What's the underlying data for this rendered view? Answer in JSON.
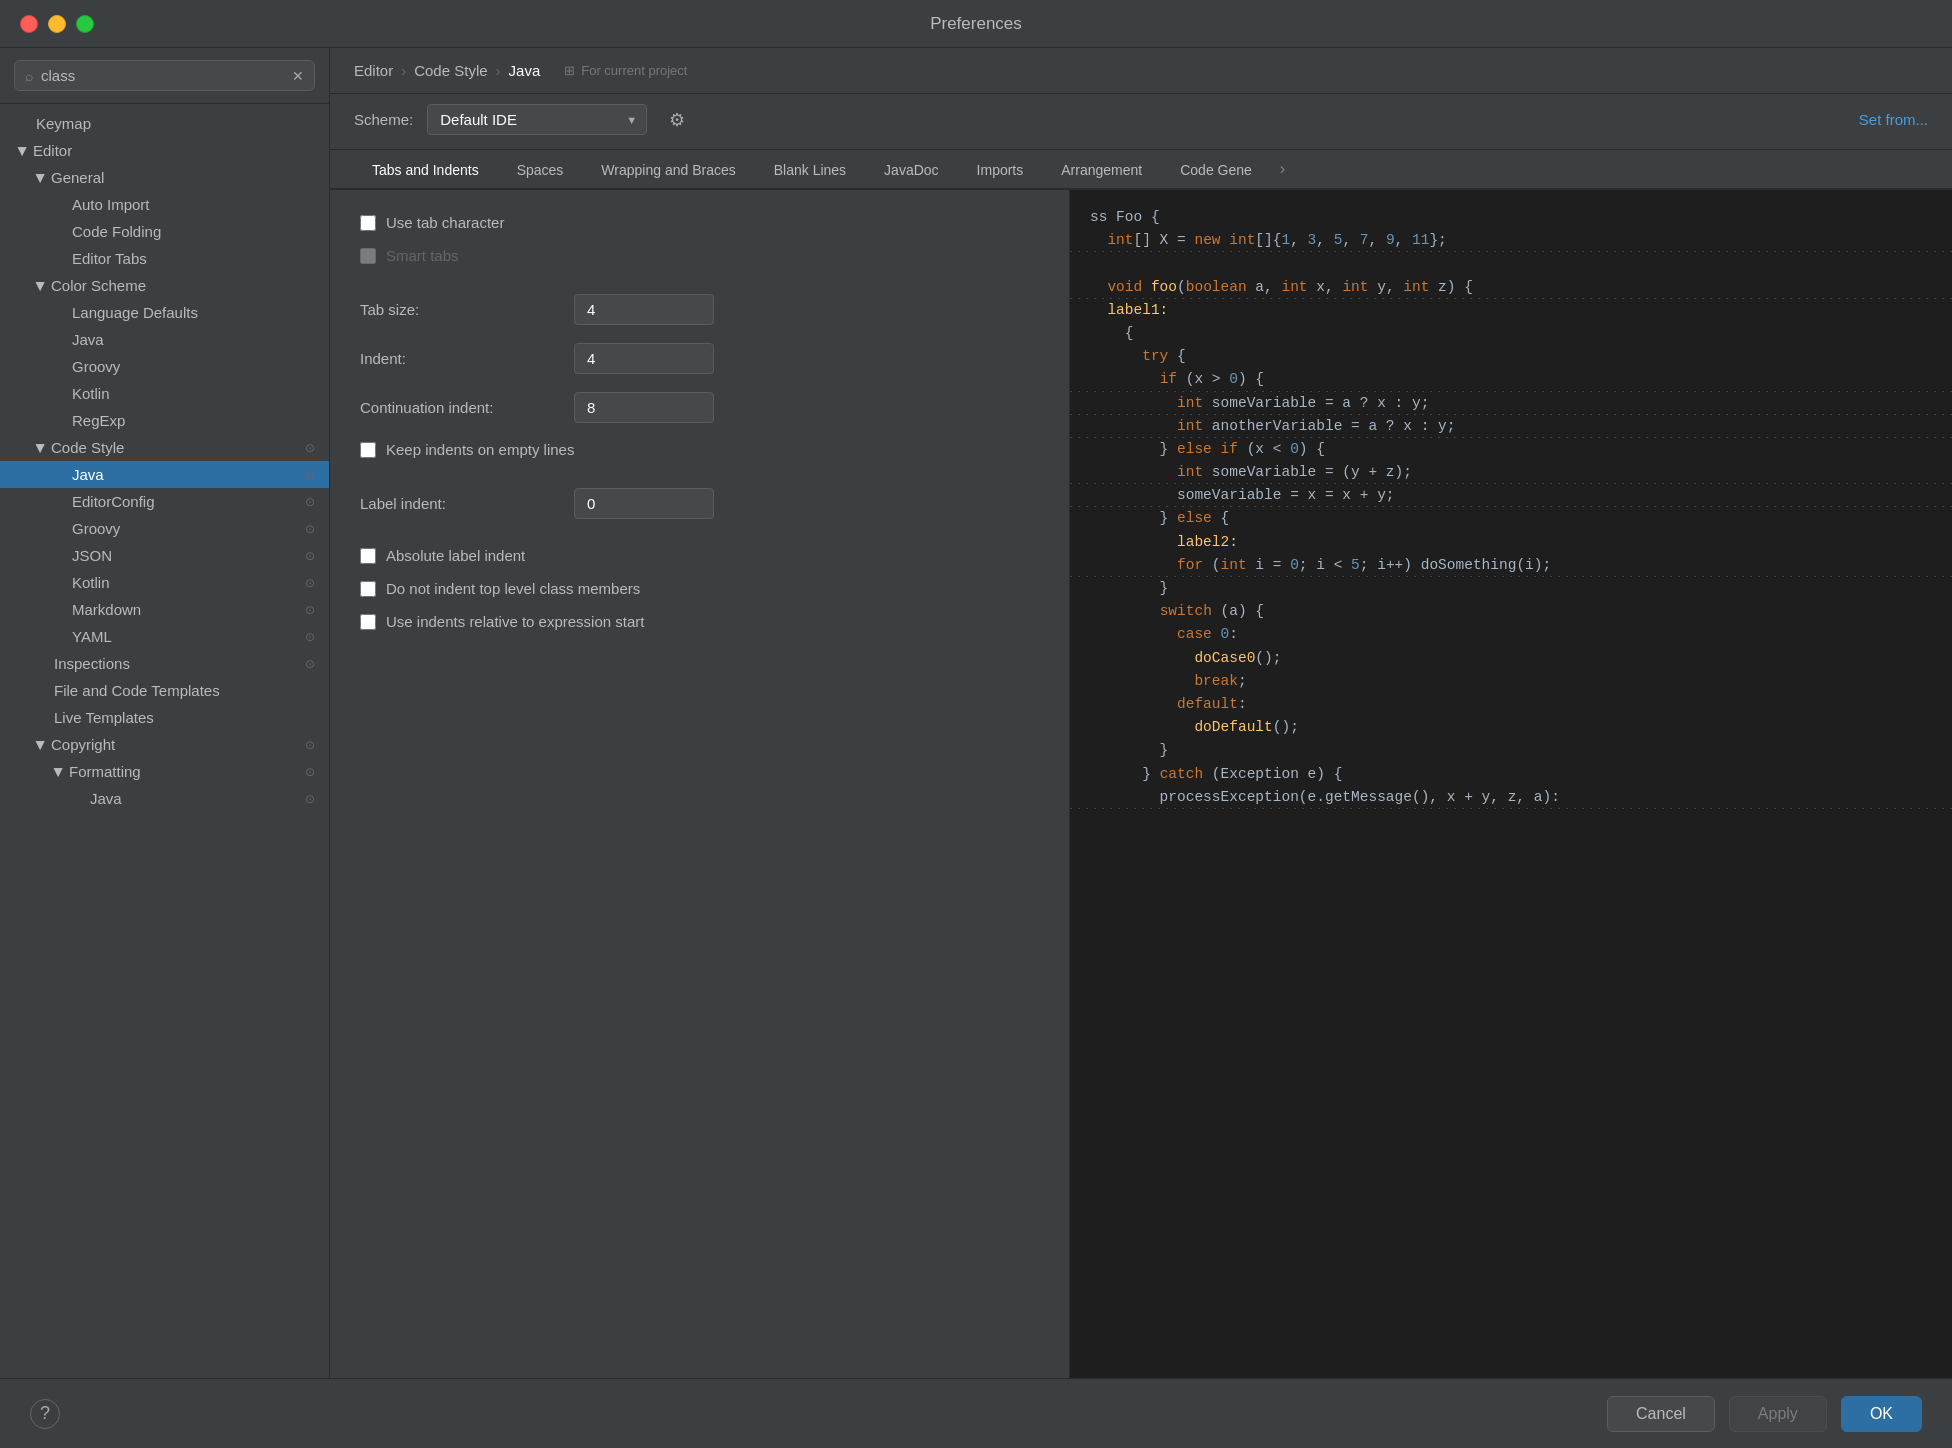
{
  "window": {
    "title": "Preferences"
  },
  "sidebar": {
    "search": {
      "value": "class",
      "placeholder": "class"
    },
    "tree": [
      {
        "id": "keymap",
        "label": "Keymap",
        "level": 0,
        "type": "item",
        "indent": 0
      },
      {
        "id": "editor",
        "label": "Editor",
        "level": 0,
        "type": "parent",
        "expanded": true,
        "indent": 0
      },
      {
        "id": "general",
        "label": "General",
        "level": 1,
        "type": "parent",
        "expanded": true,
        "indent": 1
      },
      {
        "id": "auto-import",
        "label": "Auto Import",
        "level": 2,
        "type": "item",
        "indent": 2
      },
      {
        "id": "code-folding",
        "label": "Code Folding",
        "level": 2,
        "type": "item",
        "indent": 2
      },
      {
        "id": "editor-tabs",
        "label": "Editor Tabs",
        "level": 2,
        "type": "item",
        "indent": 2
      },
      {
        "id": "color-scheme",
        "label": "Color Scheme",
        "level": 1,
        "type": "parent",
        "expanded": true,
        "indent": 1
      },
      {
        "id": "language-defaults",
        "label": "Language Defaults",
        "level": 2,
        "type": "item",
        "indent": 2
      },
      {
        "id": "java-color",
        "label": "Java",
        "level": 2,
        "type": "item",
        "indent": 2
      },
      {
        "id": "groovy-color",
        "label": "Groovy",
        "level": 2,
        "type": "item",
        "indent": 2
      },
      {
        "id": "kotlin-color",
        "label": "Kotlin",
        "level": 2,
        "type": "item",
        "indent": 2
      },
      {
        "id": "regexp-color",
        "label": "RegExp",
        "level": 2,
        "type": "item",
        "indent": 2
      },
      {
        "id": "code-style",
        "label": "Code Style",
        "level": 1,
        "type": "parent",
        "expanded": true,
        "selected": false,
        "hasCopy": true,
        "indent": 1
      },
      {
        "id": "java-cs",
        "label": "Java",
        "level": 2,
        "type": "item",
        "selected": true,
        "hasCopy": true,
        "indent": 2
      },
      {
        "id": "editorconfig",
        "label": "EditorConfig",
        "level": 2,
        "type": "item",
        "hasCopy": true,
        "indent": 2
      },
      {
        "id": "groovy-cs",
        "label": "Groovy",
        "level": 2,
        "type": "item",
        "hasCopy": true,
        "indent": 2
      },
      {
        "id": "json-cs",
        "label": "JSON",
        "level": 2,
        "type": "item",
        "hasCopy": true,
        "indent": 2
      },
      {
        "id": "kotlin-cs",
        "label": "Kotlin",
        "level": 2,
        "type": "item",
        "hasCopy": true,
        "indent": 2
      },
      {
        "id": "markdown-cs",
        "label": "Markdown",
        "level": 2,
        "type": "item",
        "hasCopy": true,
        "indent": 2
      },
      {
        "id": "yaml-cs",
        "label": "YAML",
        "level": 2,
        "type": "item",
        "hasCopy": true,
        "indent": 2
      },
      {
        "id": "inspections",
        "label": "Inspections",
        "level": 1,
        "type": "item",
        "hasCopy": true,
        "indent": 1
      },
      {
        "id": "file-code-templates",
        "label": "File and Code Templates",
        "level": 1,
        "type": "item",
        "indent": 1
      },
      {
        "id": "live-templates",
        "label": "Live Templates",
        "level": 1,
        "type": "item",
        "indent": 1
      },
      {
        "id": "copyright",
        "label": "Copyright",
        "level": 1,
        "type": "parent",
        "expanded": true,
        "hasCopy": true,
        "indent": 1
      },
      {
        "id": "formatting",
        "label": "Formatting",
        "level": 2,
        "type": "parent",
        "expanded": true,
        "hasCopy": true,
        "indent": 2
      },
      {
        "id": "java-fmt",
        "label": "Java",
        "level": 3,
        "type": "item",
        "hasCopy": true,
        "indent": 3
      }
    ]
  },
  "breadcrumb": {
    "items": [
      "Editor",
      "Code Style",
      "Java"
    ],
    "project_label": "For current project"
  },
  "scheme": {
    "label": "Scheme:",
    "value": "Default IDE",
    "set_from_label": "Set from..."
  },
  "tabs": {
    "items": [
      {
        "id": "tabs-indents",
        "label": "Tabs and Indents",
        "active": true
      },
      {
        "id": "spaces",
        "label": "Spaces"
      },
      {
        "id": "wrapping-braces",
        "label": "Wrapping and Braces"
      },
      {
        "id": "blank-lines",
        "label": "Blank Lines"
      },
      {
        "id": "javadoc",
        "label": "JavaDoc"
      },
      {
        "id": "imports",
        "label": "Imports"
      },
      {
        "id": "arrangement",
        "label": "Arrangement"
      },
      {
        "id": "code-gen",
        "label": "Code Gene"
      }
    ],
    "more": "›"
  },
  "settings": {
    "checkboxes": [
      {
        "id": "use-tab-char",
        "label": "Use tab character",
        "checked": false,
        "disabled": false
      },
      {
        "id": "smart-tabs",
        "label": "Smart tabs",
        "checked": false,
        "disabled": true
      }
    ],
    "fields": [
      {
        "id": "tab-size",
        "label": "Tab size:",
        "value": "4"
      },
      {
        "id": "indent",
        "label": "Indent:",
        "value": "4"
      },
      {
        "id": "continuation-indent",
        "label": "Continuation indent:",
        "value": "8"
      }
    ],
    "checkboxes2": [
      {
        "id": "keep-indents",
        "label": "Keep indents on empty lines",
        "checked": false,
        "disabled": false
      }
    ],
    "fields2": [
      {
        "id": "label-indent",
        "label": "Label indent:",
        "value": "0"
      }
    ],
    "checkboxes3": [
      {
        "id": "absolute-label",
        "label": "Absolute label indent",
        "checked": false,
        "disabled": false
      },
      {
        "id": "no-indent-top",
        "label": "Do not indent top level class members",
        "checked": false,
        "disabled": false
      },
      {
        "id": "use-indents-relative",
        "label": "Use indents relative to expression start",
        "checked": false,
        "disabled": false
      }
    ]
  },
  "code_preview": {
    "lines": [
      {
        "text": "ss Foo {",
        "tokens": [
          {
            "t": "plain",
            "v": "ss Foo {"
          }
        ]
      },
      {
        "text": "  int[] X = new int[]{1, 3, 5, 7, 9, 11};",
        "dotted": true,
        "tokens": [
          {
            "t": "plain",
            "v": "  "
          },
          {
            "t": "kw",
            "v": "int"
          },
          {
            "t": "plain",
            "v": "[] X = "
          },
          {
            "t": "kw",
            "v": "new"
          },
          {
            "t": "plain",
            "v": " "
          },
          {
            "t": "kw",
            "v": "int"
          },
          {
            "t": "plain",
            "v": "[]{"
          },
          {
            "t": "num",
            "v": "1"
          },
          {
            "t": "plain",
            "v": ", "
          },
          {
            "t": "num",
            "v": "3"
          },
          {
            "t": "plain",
            "v": ", "
          },
          {
            "t": "num",
            "v": "5"
          },
          {
            "t": "plain",
            "v": ", "
          },
          {
            "t": "num",
            "v": "7"
          },
          {
            "t": "plain",
            "v": ", "
          },
          {
            "t": "num",
            "v": "9"
          },
          {
            "t": "plain",
            "v": ", "
          },
          {
            "t": "num",
            "v": "11"
          },
          {
            "t": "plain",
            "v": "};"
          }
        ]
      },
      {
        "text": "",
        "tokens": []
      },
      {
        "text": "  void foo(boolean a, int x, int y, int z) {",
        "dotted": true,
        "tokens": [
          {
            "t": "plain",
            "v": "  "
          },
          {
            "t": "kw",
            "v": "void"
          },
          {
            "t": "plain",
            "v": " "
          },
          {
            "t": "fn",
            "v": "foo"
          },
          {
            "t": "plain",
            "v": "("
          },
          {
            "t": "kw",
            "v": "boolean"
          },
          {
            "t": "plain",
            "v": " a, "
          },
          {
            "t": "kw",
            "v": "int"
          },
          {
            "t": "plain",
            "v": " x, "
          },
          {
            "t": "kw",
            "v": "int"
          },
          {
            "t": "plain",
            "v": " y, "
          },
          {
            "t": "kw",
            "v": "int"
          },
          {
            "t": "plain",
            "v": " z) {"
          }
        ]
      },
      {
        "text": "  label1:",
        "tokens": [
          {
            "t": "plain",
            "v": "  "
          },
          {
            "t": "lbl",
            "v": "label1:"
          }
        ]
      },
      {
        "text": "    {",
        "tokens": [
          {
            "t": "plain",
            "v": "    {"
          }
        ]
      },
      {
        "text": "      try {",
        "tokens": [
          {
            "t": "plain",
            "v": "      "
          },
          {
            "t": "kw",
            "v": "try"
          },
          {
            "t": "plain",
            "v": " {"
          }
        ]
      },
      {
        "text": "        if (x > 0) {",
        "dotted": true,
        "tokens": [
          {
            "t": "plain",
            "v": "        "
          },
          {
            "t": "kw",
            "v": "if"
          },
          {
            "t": "plain",
            "v": " (x > "
          },
          {
            "t": "num",
            "v": "0"
          },
          {
            "t": "plain",
            "v": ") {"
          }
        ]
      },
      {
        "text": "          int someVariable = a ? x : y;",
        "dotted": true,
        "tokens": [
          {
            "t": "plain",
            "v": "          "
          },
          {
            "t": "kw",
            "v": "int"
          },
          {
            "t": "plain",
            "v": " someVariable = a ? x : y;"
          }
        ]
      },
      {
        "text": "          int anotherVariable = a ? x : y;",
        "dotted": true,
        "tokens": [
          {
            "t": "plain",
            "v": "          "
          },
          {
            "t": "kw",
            "v": "int"
          },
          {
            "t": "plain",
            "v": " anotherVariable = a ? x : y;"
          }
        ]
      },
      {
        "text": "        } else if (x < 0) {",
        "tokens": [
          {
            "t": "plain",
            "v": "        } "
          },
          {
            "t": "kw",
            "v": "else"
          },
          {
            "t": "plain",
            "v": " "
          },
          {
            "t": "kw",
            "v": "if"
          },
          {
            "t": "plain",
            "v": " (x < "
          },
          {
            "t": "num",
            "v": "0"
          },
          {
            "t": "plain",
            "v": ") {"
          }
        ]
      },
      {
        "text": "          int someVariable = (y + z);",
        "dotted": true,
        "tokens": [
          {
            "t": "plain",
            "v": "          "
          },
          {
            "t": "kw",
            "v": "int"
          },
          {
            "t": "plain",
            "v": " someVariable = (y + z);"
          }
        ]
      },
      {
        "text": "          someVariable = x = x + y;",
        "dotted": true,
        "tokens": [
          {
            "t": "plain",
            "v": "          someVariable = x = x + y;"
          }
        ]
      },
      {
        "text": "        } else {",
        "tokens": [
          {
            "t": "plain",
            "v": "        } "
          },
          {
            "t": "kw",
            "v": "else"
          },
          {
            "t": "plain",
            "v": " {"
          }
        ]
      },
      {
        "text": "          label2:",
        "tokens": [
          {
            "t": "plain",
            "v": "          "
          },
          {
            "t": "lbl",
            "v": "label2:"
          }
        ]
      },
      {
        "text": "          for (int i = 0; i < 5; i++) doSomething(i);",
        "dotted": true,
        "tokens": [
          {
            "t": "plain",
            "v": "          "
          },
          {
            "t": "kw",
            "v": "for"
          },
          {
            "t": "plain",
            "v": " ("
          },
          {
            "t": "kw",
            "v": "int"
          },
          {
            "t": "plain",
            "v": " i = "
          },
          {
            "t": "num",
            "v": "0"
          },
          {
            "t": "plain",
            "v": "; i < "
          },
          {
            "t": "num",
            "v": "5"
          },
          {
            "t": "plain",
            "v": "; i++) doSomething(i);"
          }
        ]
      },
      {
        "text": "        }",
        "tokens": [
          {
            "t": "plain",
            "v": "        }"
          }
        ]
      },
      {
        "text": "        switch (a) {",
        "tokens": [
          {
            "t": "plain",
            "v": "        "
          },
          {
            "t": "kw",
            "v": "switch"
          },
          {
            "t": "plain",
            "v": " (a) {"
          }
        ]
      },
      {
        "text": "          case 0:",
        "tokens": [
          {
            "t": "plain",
            "v": "          "
          },
          {
            "t": "kw",
            "v": "case"
          },
          {
            "t": "plain",
            "v": " "
          },
          {
            "t": "num",
            "v": "0"
          },
          {
            "t": "plain",
            "v": ":"
          }
        ]
      },
      {
        "text": "            doCase0();",
        "tokens": [
          {
            "t": "plain",
            "v": "            "
          },
          {
            "t": "fn",
            "v": "doCase0"
          },
          {
            "t": "plain",
            "v": "();"
          }
        ]
      },
      {
        "text": "            break;",
        "tokens": [
          {
            "t": "plain",
            "v": "            "
          },
          {
            "t": "kw",
            "v": "break"
          },
          {
            "t": "plain",
            "v": ";"
          }
        ]
      },
      {
        "text": "          default:",
        "tokens": [
          {
            "t": "plain",
            "v": "          "
          },
          {
            "t": "kw",
            "v": "default"
          },
          {
            "t": "plain",
            "v": ":"
          }
        ]
      },
      {
        "text": "            doDefault();",
        "tokens": [
          {
            "t": "plain",
            "v": "            "
          },
          {
            "t": "fn",
            "v": "doDefault"
          },
          {
            "t": "plain",
            "v": "();"
          }
        ]
      },
      {
        "text": "        }",
        "tokens": [
          {
            "t": "plain",
            "v": "        }"
          }
        ]
      },
      {
        "text": "      } catch (Exception e) {",
        "tokens": [
          {
            "t": "plain",
            "v": "      } "
          },
          {
            "t": "kw",
            "v": "catch"
          },
          {
            "t": "plain",
            "v": " ("
          },
          {
            "t": "cls",
            "v": "Exception"
          },
          {
            "t": "plain",
            "v": " e) {"
          }
        ]
      },
      {
        "text": "        processException(e.getMessage(), x + y, z, a):",
        "dotted": true,
        "tokens": [
          {
            "t": "plain",
            "v": "        processException(e.getMessage(), x + y, z, a):"
          }
        ]
      }
    ]
  },
  "bottom": {
    "help_label": "?",
    "cancel_label": "Cancel",
    "apply_label": "Apply",
    "ok_label": "OK"
  }
}
